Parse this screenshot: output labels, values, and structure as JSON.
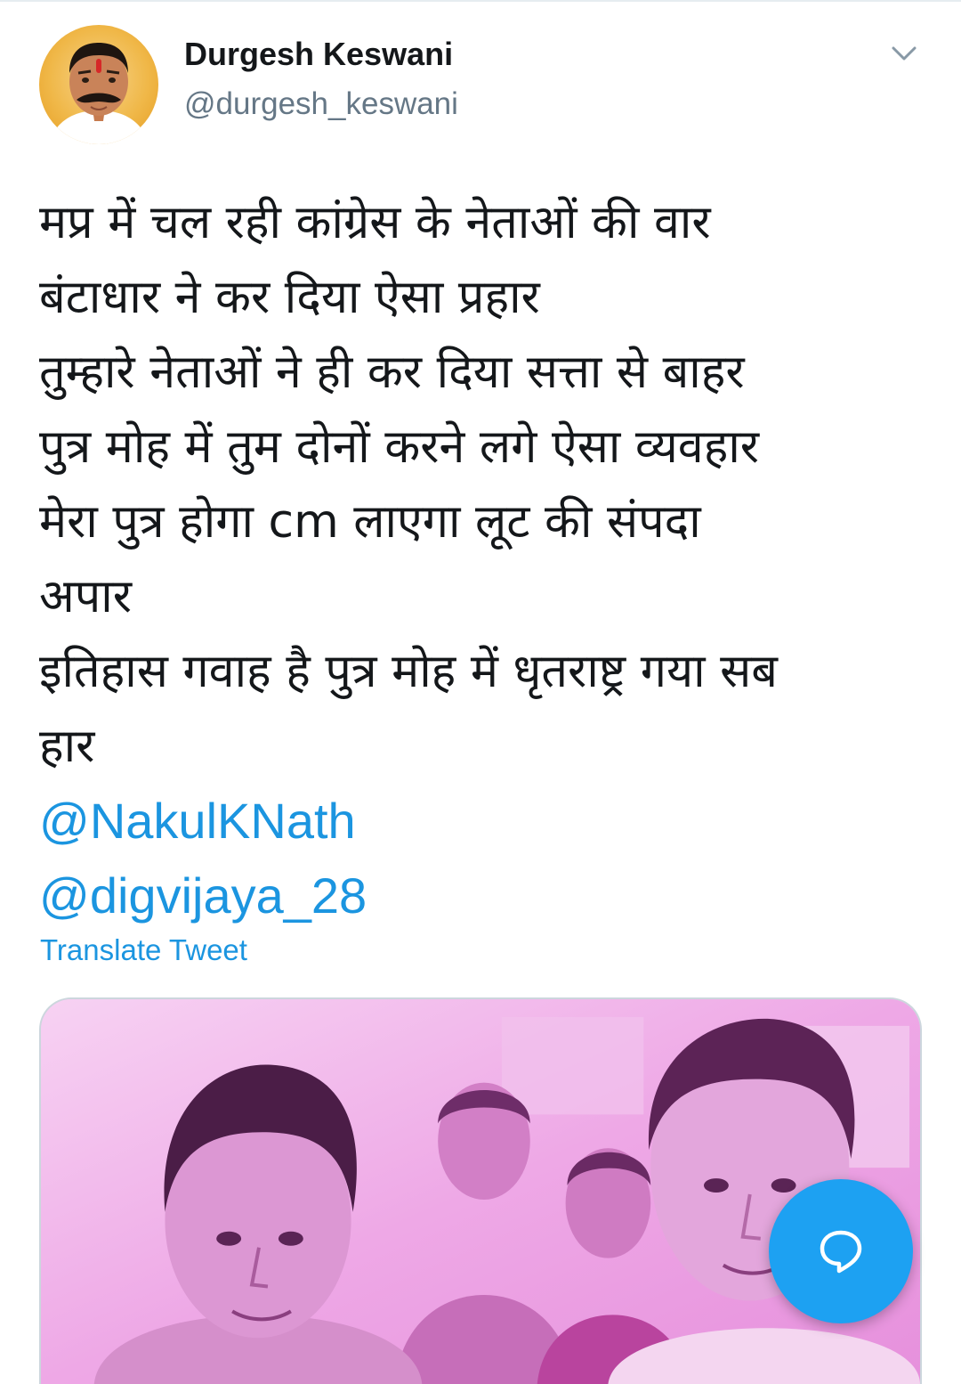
{
  "tweet": {
    "author": {
      "display_name": "Durgesh Keswani",
      "handle": "@durgesh_keswani"
    },
    "text_lines": [
      "मप्र में चल रही कांग्रेस के नेताओं की वार",
      "बंटाधार ने कर दिया ऐसा प्रहार",
      "तुम्हारे नेताओं ने ही कर दिया सत्ता से बाहर",
      "पुत्र मोह में तुम दोनों करने लगे ऐसा व्यवहार",
      "मेरा पुत्र होगा cm लाएगा लूट की संपदा",
      "अपार",
      "इतिहास गवाह है पुत्र मोह में धृतराष्ट्र गया सब",
      "हार"
    ],
    "mentions": [
      "@NakulKNath",
      "@digvijaya_28"
    ],
    "translate_label": "Translate Tweet"
  },
  "icons": {
    "menu": "chevron-down-icon",
    "compose": "chat-bubble-icon"
  },
  "colors": {
    "link": "#1b95e0",
    "fab": "#1da1f2",
    "secondary_text": "#657786",
    "primary_text": "#14171a"
  }
}
